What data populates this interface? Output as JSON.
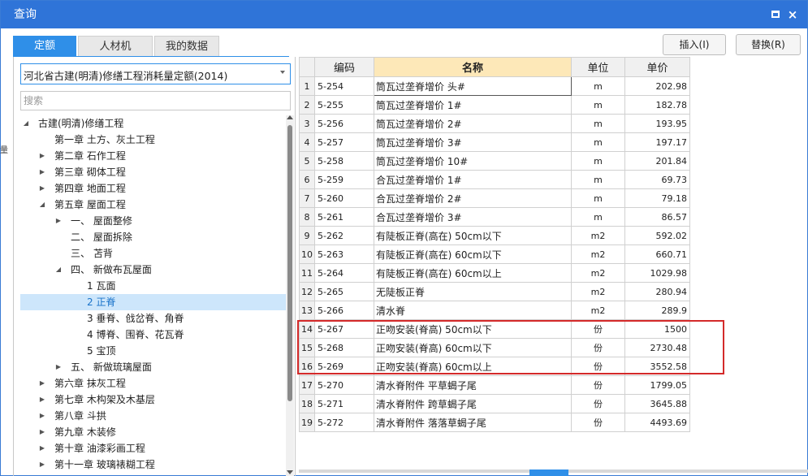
{
  "window": {
    "title": "查询",
    "maximize_label": "",
    "close_label": "×"
  },
  "tabs": [
    {
      "label": "定额"
    },
    {
      "label": "人材机"
    },
    {
      "label": "我的数据"
    }
  ],
  "toolbar": {
    "insert_label": "插入(I)",
    "replace_label": "替换(R)"
  },
  "left": {
    "library_select_value": "河北省古建(明清)修缮工程消耗量定额(2014)",
    "search_placeholder": "搜索",
    "edge_label": "量",
    "tree": [
      {
        "label": "古建(明清)修缮工程",
        "expander": "◢",
        "level": 0
      },
      {
        "label": "第一章 土方、灰土工程",
        "expander": "",
        "level": 1
      },
      {
        "label": "第二章 石作工程",
        "expander": "▶",
        "level": 1
      },
      {
        "label": "第三章 砌体工程",
        "expander": "▶",
        "level": 1
      },
      {
        "label": "第四章 地面工程",
        "expander": "▶",
        "level": 1
      },
      {
        "label": "第五章 屋面工程",
        "expander": "◢",
        "level": 1
      },
      {
        "label": "一、  屋面整修",
        "expander": "▶",
        "level": 2
      },
      {
        "label": "二、  屋面拆除",
        "expander": "",
        "level": 2
      },
      {
        "label": "三、  苫背",
        "expander": "",
        "level": 2
      },
      {
        "label": "四、  新做布瓦屋面",
        "expander": "◢",
        "level": 2
      },
      {
        "label": "1 瓦面",
        "expander": "",
        "level": 3
      },
      {
        "label": "2 正脊",
        "expander": "",
        "level": 3,
        "selected": true
      },
      {
        "label": "3 垂脊、戗岔脊、角脊",
        "expander": "",
        "level": 3
      },
      {
        "label": "4 博脊、围脊、花瓦脊",
        "expander": "",
        "level": 3
      },
      {
        "label": "5 宝顶",
        "expander": "",
        "level": 3
      },
      {
        "label": "五、  新做琉璃屋面",
        "expander": "▶",
        "level": 2
      },
      {
        "label": "第六章 抹灰工程",
        "expander": "▶",
        "level": 1
      },
      {
        "label": "第七章 木构架及木基层",
        "expander": "▶",
        "level": 1
      },
      {
        "label": "第八章 斗拱",
        "expander": "▶",
        "level": 1
      },
      {
        "label": "第九章 木装修",
        "expander": "▶",
        "level": 1
      },
      {
        "label": "第十章 油漆彩画工程",
        "expander": "▶",
        "level": 1
      },
      {
        "label": "第十一章 玻璃裱糊工程",
        "expander": "▶",
        "level": 1
      }
    ]
  },
  "grid": {
    "columns": [
      "编码",
      "名称",
      "单位",
      "单价"
    ],
    "rows": [
      {
        "idx": "1",
        "code": "5-254",
        "name": "筒瓦过垄脊增价 头#",
        "unit": "m",
        "price": "202.98"
      },
      {
        "idx": "2",
        "code": "5-255",
        "name": "筒瓦过垄脊增价 1#",
        "unit": "m",
        "price": "182.78"
      },
      {
        "idx": "3",
        "code": "5-256",
        "name": "筒瓦过垄脊增价 2#",
        "unit": "m",
        "price": "193.95"
      },
      {
        "idx": "4",
        "code": "5-257",
        "name": "筒瓦过垄脊增价 3#",
        "unit": "m",
        "price": "197.17"
      },
      {
        "idx": "5",
        "code": "5-258",
        "name": "筒瓦过垄脊增价 10#",
        "unit": "m",
        "price": "201.84"
      },
      {
        "idx": "6",
        "code": "5-259",
        "name": "合瓦过垄脊增价 1#",
        "unit": "m",
        "price": "69.73"
      },
      {
        "idx": "7",
        "code": "5-260",
        "name": "合瓦过垄脊增价 2#",
        "unit": "m",
        "price": "79.18"
      },
      {
        "idx": "8",
        "code": "5-261",
        "name": "合瓦过垄脊增价 3#",
        "unit": "m",
        "price": "86.57"
      },
      {
        "idx": "9",
        "code": "5-262",
        "name": "有陡板正脊(高在) 50cm以下",
        "unit": "m2",
        "price": "592.02"
      },
      {
        "idx": "10",
        "code": "5-263",
        "name": "有陡板正脊(高在) 60cm以下",
        "unit": "m2",
        "price": "660.71"
      },
      {
        "idx": "11",
        "code": "5-264",
        "name": "有陡板正脊(高在) 60cm以上",
        "unit": "m2",
        "price": "1029.98"
      },
      {
        "idx": "12",
        "code": "5-265",
        "name": "无陡板正脊",
        "unit": "m2",
        "price": "280.94"
      },
      {
        "idx": "13",
        "code": "5-266",
        "name": "清水脊",
        "unit": "m2",
        "price": "289.9"
      },
      {
        "idx": "14",
        "code": "5-267",
        "name": "正吻安装(脊高) 50cm以下",
        "unit": "份",
        "price": "1500"
      },
      {
        "idx": "15",
        "code": "5-268",
        "name": "正吻安装(脊高) 60cm以下",
        "unit": "份",
        "price": "2730.48"
      },
      {
        "idx": "16",
        "code": "5-269",
        "name": "正吻安装(脊高) 60cm以上",
        "unit": "份",
        "price": "3552.58"
      },
      {
        "idx": "17",
        "code": "5-270",
        "name": "清水脊附件 平草蝎子尾",
        "unit": "份",
        "price": "1799.05"
      },
      {
        "idx": "18",
        "code": "5-271",
        "name": "清水脊附件 跨草蝎子尾",
        "unit": "份",
        "price": "3645.88"
      },
      {
        "idx": "19",
        "code": "5-272",
        "name": "清水脊附件 落落草蝎子尾",
        "unit": "份",
        "price": "4493.69"
      }
    ]
  },
  "colors": {
    "titlebar": "#2f74d8",
    "active_tab": "#2f8fe8",
    "name_header": "#fde8b8",
    "highlight_box": "#d42a2a",
    "selected_tree_row": "#cde6fb"
  }
}
